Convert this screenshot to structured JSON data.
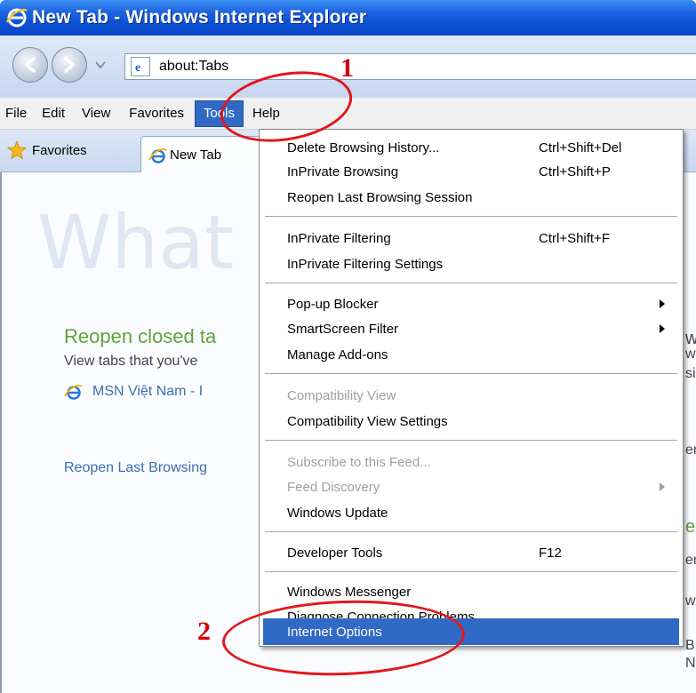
{
  "window": {
    "title": "New Tab - Windows Internet Explorer"
  },
  "address": {
    "url": "about:Tabs"
  },
  "menubar": {
    "items": [
      {
        "label": "File"
      },
      {
        "label": "Edit"
      },
      {
        "label": "View"
      },
      {
        "label": "Favorites"
      },
      {
        "label": "Tools"
      },
      {
        "label": "Help"
      }
    ]
  },
  "tabbar": {
    "favorites_label": "Favorites",
    "tab_label": "New Tab"
  },
  "content": {
    "big_heading": "What d",
    "reopen_closed": "Reopen closed ta",
    "view_tabs": "View tabs that you've",
    "msn_link": "MSN Việt Nam - I",
    "reopen_last": "Reopen Last Browsing",
    "right_fragments": [
      "w",
      "w",
      "si",
      "en",
      "e",
      "en",
      "w",
      "B",
      "N"
    ]
  },
  "tools_menu": {
    "items": [
      {
        "label": "Delete Browsing History...",
        "shortcut": "Ctrl+Shift+Del"
      },
      {
        "label": "InPrivate Browsing",
        "shortcut": "Ctrl+Shift+P"
      },
      {
        "label": "Reopen Last Browsing Session",
        "shortcut": ""
      },
      {
        "label": "InPrivate Filtering",
        "shortcut": "Ctrl+Shift+F"
      },
      {
        "label": "InPrivate Filtering Settings",
        "shortcut": ""
      },
      {
        "label": "Pop-up Blocker",
        "shortcut": ""
      },
      {
        "label": "SmartScreen Filter",
        "shortcut": ""
      },
      {
        "label": "Manage Add-ons",
        "shortcut": ""
      },
      {
        "label": "Compatibility View",
        "shortcut": ""
      },
      {
        "label": "Compatibility View Settings",
        "shortcut": ""
      },
      {
        "label": "Subscribe to this Feed...",
        "shortcut": ""
      },
      {
        "label": "Feed Discovery",
        "shortcut": ""
      },
      {
        "label": "Windows Update",
        "shortcut": ""
      },
      {
        "label": "Developer Tools",
        "shortcut": "F12"
      },
      {
        "label": "Windows Messenger",
        "shortcut": ""
      },
      {
        "label": "Diagnose Connection Problems...",
        "shortcut": ""
      },
      {
        "label": "Internet Options",
        "shortcut": ""
      }
    ]
  },
  "annotations": {
    "step1": "1",
    "step2": "2"
  },
  "colors": {
    "accent": "#316ac5",
    "annotation_red": "#e2161b",
    "link_green": "#5fa33a"
  }
}
